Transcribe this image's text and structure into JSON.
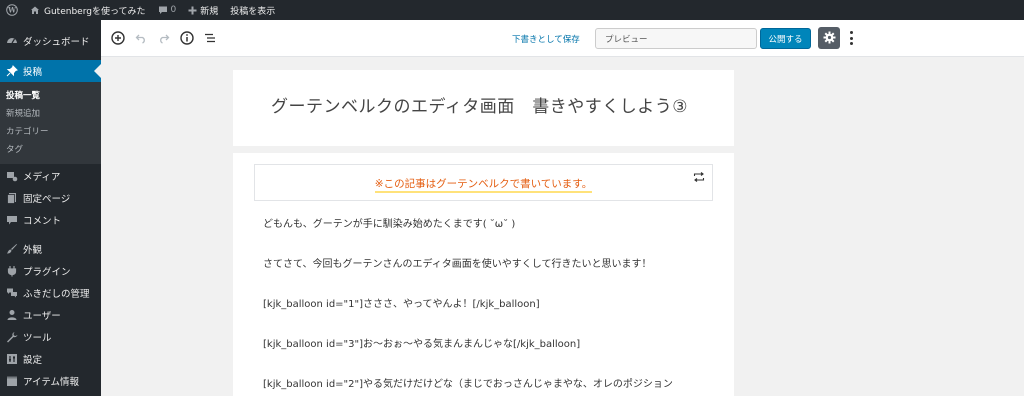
{
  "adminbar": {
    "site_name": "Gutenbergを使ってみた",
    "comments_count": "0",
    "new_label": "新規",
    "view_post_label": "投稿を表示"
  },
  "sidebar": {
    "items": [
      {
        "label": "ダッシュボード",
        "icon": "dashboard-icon"
      },
      {
        "label": "投稿",
        "icon": "pin-icon",
        "active": true
      },
      {
        "label": "メディア",
        "icon": "media-icon"
      },
      {
        "label": "固定ページ",
        "icon": "page-icon"
      },
      {
        "label": "コメント",
        "icon": "comment-icon"
      },
      {
        "label": "外観",
        "icon": "appearance-icon"
      },
      {
        "label": "プラグイン",
        "icon": "plugin-icon"
      },
      {
        "label": "ふきだしの管理",
        "icon": "balloon-icon"
      },
      {
        "label": "ユーザー",
        "icon": "user-icon"
      },
      {
        "label": "ツール",
        "icon": "tool-icon"
      },
      {
        "label": "設定",
        "icon": "settings-icon"
      },
      {
        "label": "アイテム情報",
        "icon": "item-icon"
      }
    ],
    "submenu": [
      "投稿一覧",
      "新規追加",
      "カテゴリー",
      "タグ"
    ]
  },
  "toolbar": {
    "save_draft": "下書きとして保存",
    "preview": "プレビュー",
    "publish": "公開する"
  },
  "editor": {
    "title": "グーテンベルクのエディタ画面　書きやすくしよう③",
    "notice": "※この記事はグーテンベルクで書いています。",
    "paragraphs": [
      "どもんも、グーテンが手に馴染み始めたくまです( ˘ω˘ )",
      "さてさて、今回もグーテンさんのエディタ画面を使いやすくして行きたいと思います！",
      "[kjk_balloon id=\"1\"]さささ、やってやんよ！[/kjk_balloon]",
      "[kjk_balloon id=\"3\"]お～おぉ～やる気まんまんじゃな[/kjk_balloon]",
      "[kjk_balloon id=\"2\"]やる気だけだけどな（まじでおっさんじゃまやな、オレのポジション"
    ]
  },
  "colors": {
    "admin_dark": "#23282d",
    "accent_blue": "#0073aa",
    "notice_orange": "#e45d10",
    "highlight_yellow": "#ffe27a"
  }
}
